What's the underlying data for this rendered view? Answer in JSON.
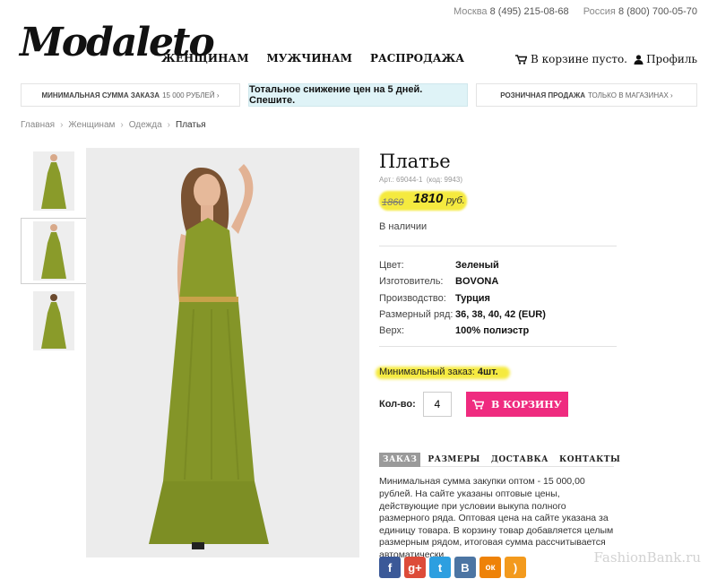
{
  "contacts": {
    "city1": "Москва",
    "phone1": "8 (495) 215-08-68",
    "city2": "Россия",
    "phone2": "8 (800) 700-05-70"
  },
  "logo": "Modaleto",
  "nav": {
    "women": "ЖЕНЩИНАМ",
    "men": "МУЖЧИНАМ",
    "sale": "РАСПРОДАЖА"
  },
  "cart_label": "В корзине пусто.",
  "profile_label": "Профиль",
  "strip": {
    "left_bold": "МИНИМАЛЬНАЯ СУММА ЗАКАЗА",
    "left_rest": "15 000 рублей ›",
    "mid": "Тотальное снижение цен на 5 дней. Спешите.",
    "right_bold": "РОЗНИЧНАЯ ПРОДАЖА",
    "right_rest": "ТОЛЬКО В МАГАЗИНАХ ›"
  },
  "breadcrumb": [
    "Главная",
    "Женщинам",
    "Одежда",
    "Платья"
  ],
  "breadcrumb_sep": "›",
  "product": {
    "title": "Платье",
    "art": "Арт.: 69044-1",
    "code": "(код: 9943)",
    "old_price": "1860",
    "price": "1810",
    "currency": "руб.",
    "stock": "В наличии",
    "specs": [
      {
        "k": "Цвет:",
        "v": "Зеленый"
      },
      {
        "k": "Изготовитель:",
        "v": "BOVONA"
      },
      {
        "k": "Производство:",
        "v": "Турция"
      },
      {
        "k": "Размерный ряд:",
        "v": "36, 38, 40, 42 (EUR)"
      },
      {
        "k": "Верх:",
        "v": "100% полиэстр"
      }
    ],
    "min_order_label": "Минимальный заказ:",
    "min_order_value": "4шт.",
    "qty_label": "Кол-во:",
    "qty_value": "4",
    "buy_label": "В КОРЗИНУ"
  },
  "tabs": [
    "ЗАКАЗ",
    "РАЗМЕРЫ",
    "ДОСТАВКА",
    "КОНТАКТЫ"
  ],
  "tab_text": "Минимальная сумма закупки оптом - 15 000,00 рублей. На сайте указаны оптовые цены, действующие при условии выкупа полного размерного ряда. Оптовая цена на сайте указана за единицу товара. В корзину товар добавляется целым размерным рядом, итоговая сумма рассчитывается автоматически.",
  "social": [
    {
      "icon": "facebook-icon",
      "glyph": "f",
      "color": "#3b5998"
    },
    {
      "icon": "google-plus-icon",
      "glyph": "g+",
      "color": "#dd4b39"
    },
    {
      "icon": "twitter-icon",
      "glyph": "t",
      "color": "#2d9fe0"
    },
    {
      "icon": "vkontakte-icon",
      "glyph": "B",
      "color": "#4c75a3"
    },
    {
      "icon": "odnoklassniki-icon",
      "glyph": "ок",
      "color": "#ee8208"
    },
    {
      "icon": "rss-icon",
      "glyph": ")",
      "color": "#f39a1d"
    }
  ],
  "colors": {
    "accent": "#ef2b7f",
    "dress": "#8a9b2a",
    "highlight": "#f5ea3f",
    "promo_bg": "#dff3f7"
  },
  "watermark": "FashionBank.ru"
}
